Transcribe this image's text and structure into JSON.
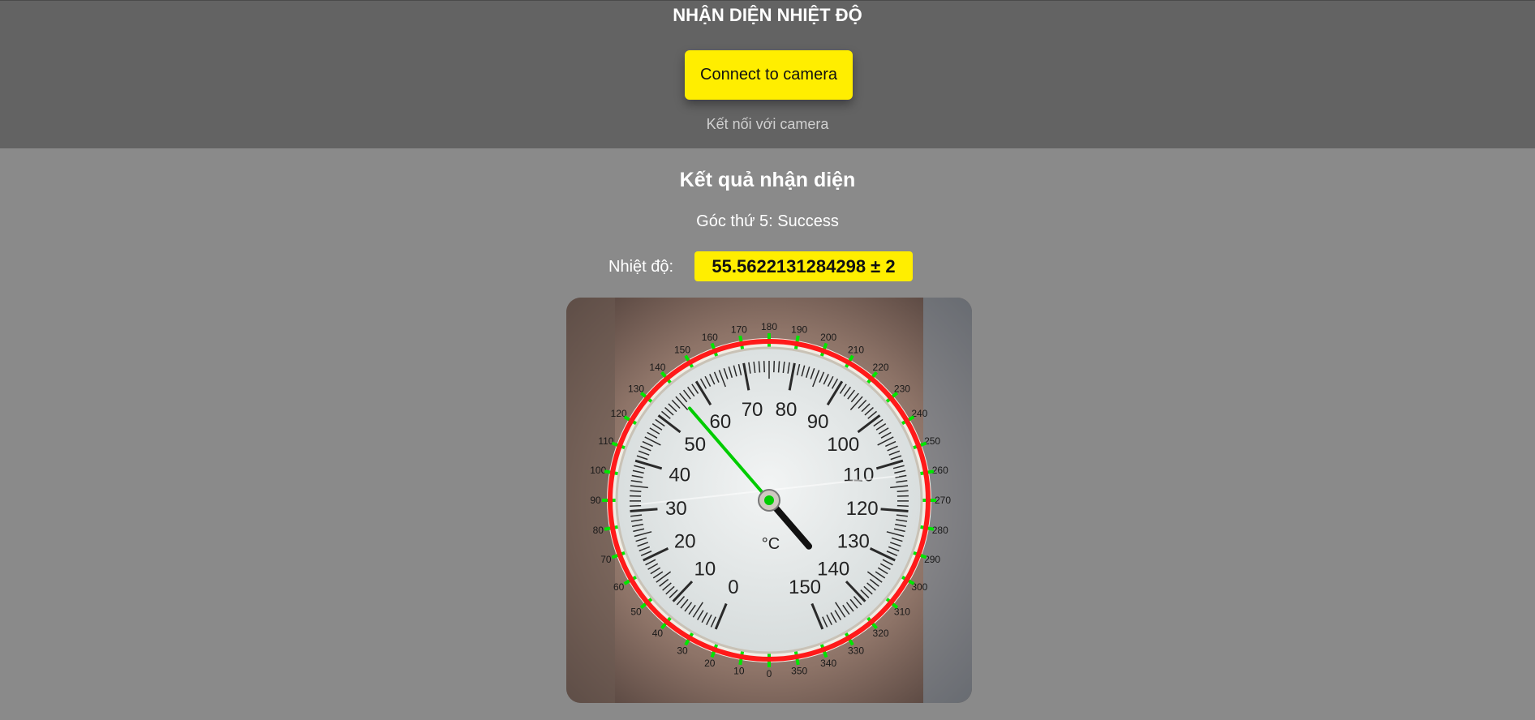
{
  "header": {
    "title": "NHẬN DIỆN NHIỆT ĐỘ",
    "connect_button": "Connect to camera",
    "connect_subtitle": "Kết nối với camera"
  },
  "result": {
    "heading": "Kết quả nhận diện",
    "status": "Góc thứ 5: Success",
    "temperature_label": "Nhiệt độ:",
    "temperature_value": "55.5622131284298 ± 2"
  },
  "gauge": {
    "unit": "°C",
    "scale_labels": [
      "0",
      "10",
      "20",
      "30",
      "40",
      "50",
      "60",
      "70",
      "80",
      "90",
      "100",
      "110",
      "120",
      "130",
      "140",
      "150"
    ],
    "angle_labels": [
      "0",
      "10",
      "20",
      "30",
      "40",
      "50",
      "60",
      "70",
      "80",
      "90",
      "100",
      "110",
      "120",
      "130",
      "140",
      "150",
      "160",
      "170",
      "180",
      "190",
      "200",
      "210",
      "220",
      "230",
      "240",
      "250",
      "260",
      "270",
      "280",
      "290",
      "300",
      "310",
      "320",
      "330",
      "340",
      "350"
    ],
    "colors": {
      "ring": "#ff1a1a",
      "detected_marks": "#00e600",
      "needle": "#111111",
      "detected_needle": "#00cc00",
      "face": "#e9ecec"
    },
    "reading": 55.5622131284298
  }
}
